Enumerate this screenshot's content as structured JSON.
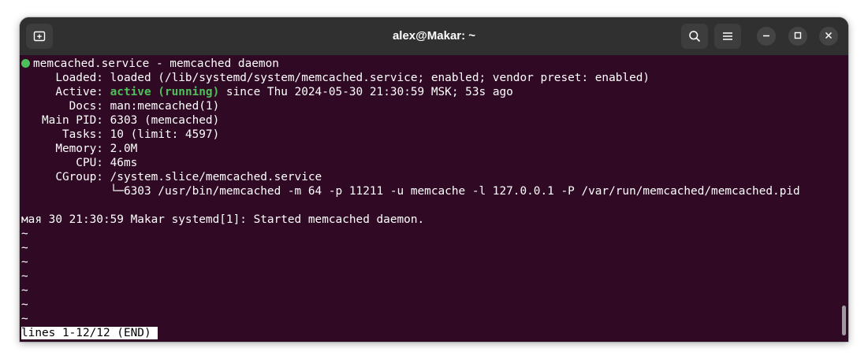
{
  "window": {
    "title": "alex@Makar: ~"
  },
  "titlebar": {
    "new_tab_icon": "new-tab-icon",
    "search_icon": "search-icon",
    "menu_icon": "hamburger-menu-icon",
    "minimize_icon": "minimize-icon",
    "maximize_icon": "maximize-icon",
    "close_icon": "close-icon"
  },
  "terminal": {
    "colors": {
      "background": "#300a24",
      "foreground": "#ffffff",
      "status_green": "#4ec05a"
    },
    "service_line": "memcached.service - memcached daemon",
    "loaded_line": "     Loaded: loaded (/lib/systemd/system/memcached.service; enabled; vendor preset: enabled)",
    "active_prefix": "     Active: ",
    "active_status": "active (running)",
    "active_suffix": " since Thu 2024-05-30 21:30:59 MSK; 53s ago",
    "docs_line": "       Docs: man:memcached(1)",
    "main_pid_line": "   Main PID: 6303 (memcached)",
    "tasks_line": "      Tasks: 10 (limit: 4597)",
    "memory_line": "     Memory: 2.0M",
    "cpu_line": "        CPU: 46ms",
    "cgroup_line": "     CGroup: /system.slice/memcached.service",
    "cgroup_process_line": "             └─6303 /usr/bin/memcached -m 64 -p 11211 -u memcache -l 127.0.0.1 -P /var/run/memcached/memcached.pid",
    "log_line": "мая 30 21:30:59 Makar systemd[1]: Started memcached daemon.",
    "tilde_lines": [
      "~",
      "~",
      "~",
      "~",
      "~",
      "~",
      "~"
    ],
    "status_bar": "lines 1-12/12 (END)"
  }
}
